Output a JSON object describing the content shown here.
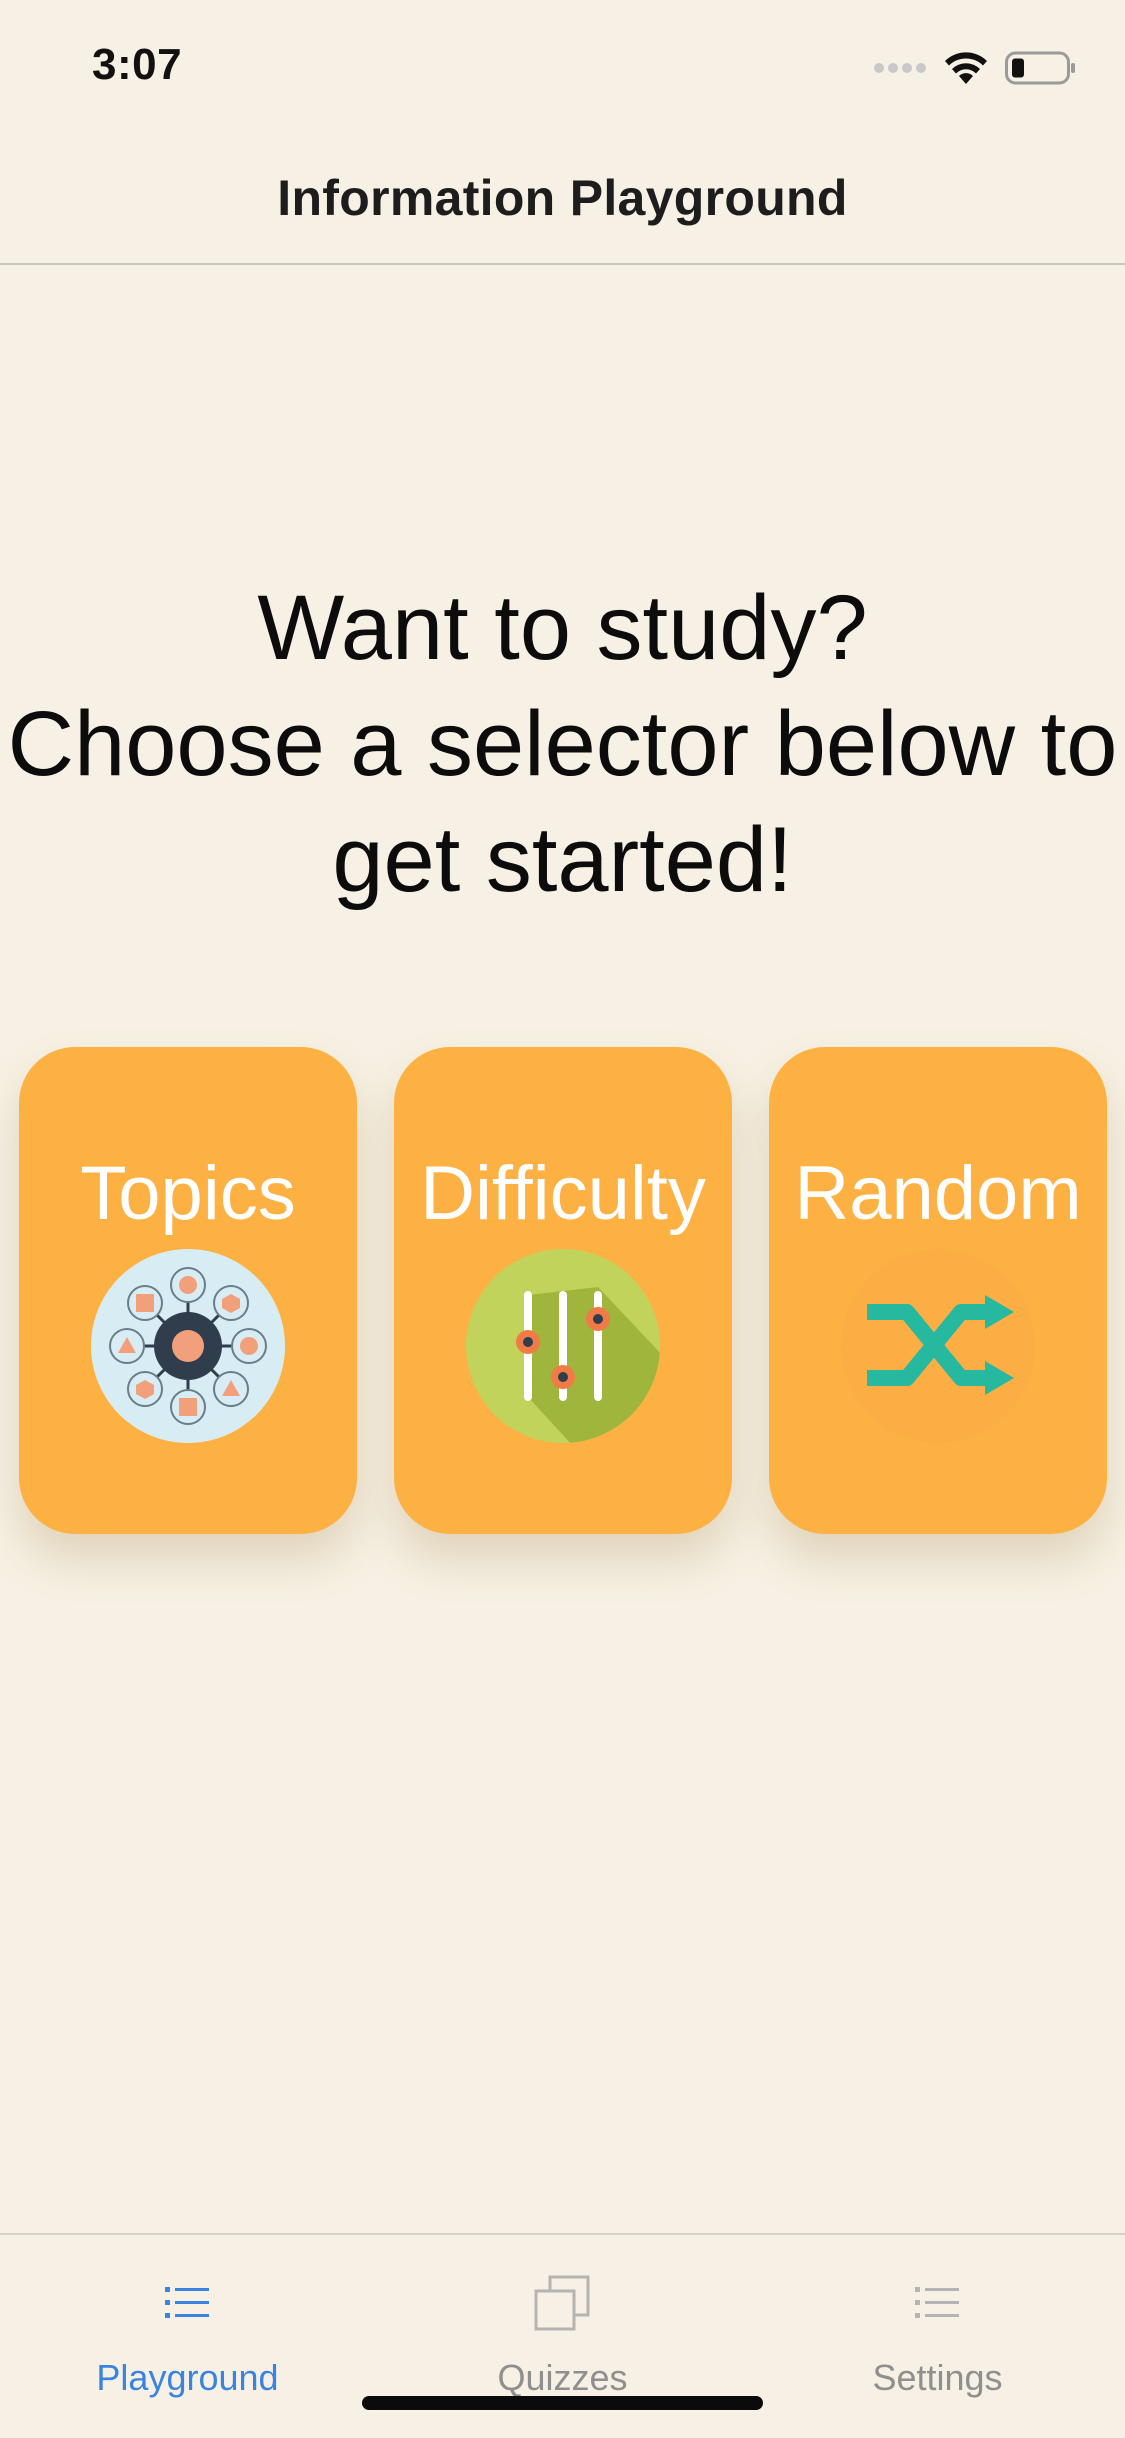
{
  "status_bar": {
    "time": "3:07",
    "icons": [
      "signal-icon",
      "wifi-icon",
      "battery-icon"
    ]
  },
  "nav": {
    "title": "Information Playground"
  },
  "prompt": {
    "line1": "Want to study?",
    "line2": "Choose a selector below to",
    "line3": "get started!"
  },
  "selectors": [
    {
      "label": "Topics",
      "icon": "topics-network-icon"
    },
    {
      "label": "Difficulty",
      "icon": "difficulty-sliders-icon"
    },
    {
      "label": "Random",
      "icon": "random-shuffle-icon"
    }
  ],
  "tabs": [
    {
      "label": "Playground",
      "icon": "list-icon",
      "active": true
    },
    {
      "label": "Quizzes",
      "icon": "stacked-squares-icon",
      "active": false
    },
    {
      "label": "Settings",
      "icon": "list-icon",
      "active": false
    }
  ],
  "colors": {
    "background": "#f6f1e4",
    "card": "#feb143",
    "tab_active": "#3b83e0",
    "tab_inactive": "#8f8f8f"
  }
}
